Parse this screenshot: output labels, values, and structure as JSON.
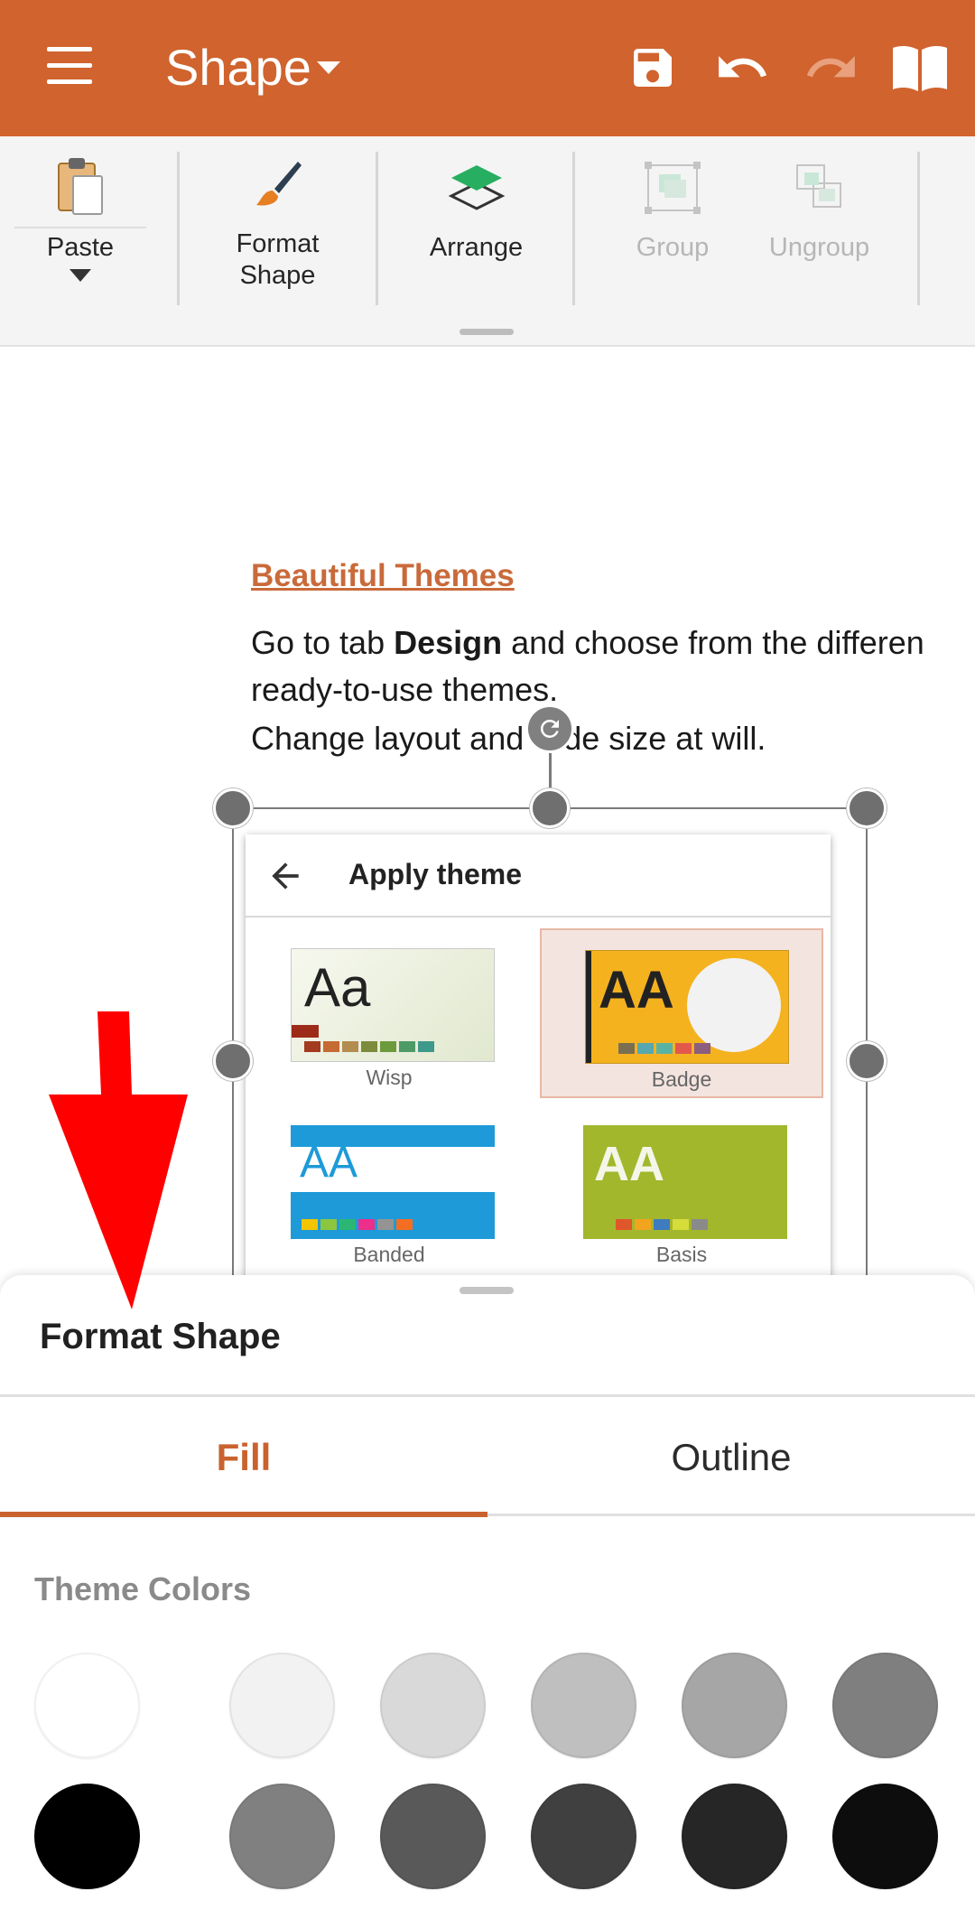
{
  "app_bar": {
    "title": "Shape",
    "menu_icon": "hamburger-menu-icon",
    "actions": [
      "save-icon",
      "undo-icon",
      "redo-icon",
      "read-mode-book-icon"
    ],
    "background_color": "#d0632e"
  },
  "ribbon": {
    "items": [
      {
        "label": "Paste",
        "icon": "clipboard-paste-icon",
        "enabled": true
      },
      {
        "label_line1": "Format",
        "label_line2": "Shape",
        "icon": "paintbrush-icon",
        "enabled": true
      },
      {
        "label": "Arrange",
        "icon": "layers-icon",
        "enabled": true
      },
      {
        "label": "Group",
        "icon": "group-icon",
        "enabled": false
      },
      {
        "label": "Ungroup",
        "icon": "ungroup-icon",
        "enabled": false
      }
    ]
  },
  "document": {
    "heading": "Beautiful Themes",
    "para_line1_pre": "Go to tab ",
    "para_line1_bold": "Design",
    "para_line1_post": " and choose from the differen",
    "para_line2": "ready-to-use themes.",
    "para_line3": "Change layout and slide size at will.",
    "embedded_image": {
      "title": "Apply theme",
      "themes": [
        {
          "name": "Wisp",
          "sample": "Aa"
        },
        {
          "name": "Badge",
          "sample": "AA",
          "selected": true
        },
        {
          "name": "Banded",
          "sample": "AA"
        },
        {
          "name": "Basis",
          "sample": "AA"
        }
      ]
    }
  },
  "bottom_sheet": {
    "title": "Format Shape",
    "tabs": [
      {
        "label": "Fill",
        "active": true
      },
      {
        "label": "Outline",
        "active": false
      }
    ],
    "section_label": "Theme Colors",
    "theme_colors_row1": [
      "#ffffff",
      "#f2f2f2",
      "#d9d9d9",
      "#bfbfbf",
      "#a6a6a6",
      "#7f7f7f"
    ],
    "theme_colors_row2": [
      "#000000",
      "#808080",
      "#595959",
      "#404040",
      "#262626",
      "#0d0d0d"
    ],
    "accent_color": "#c9622f"
  },
  "annotation": {
    "arrow_color": "#ff0000"
  }
}
